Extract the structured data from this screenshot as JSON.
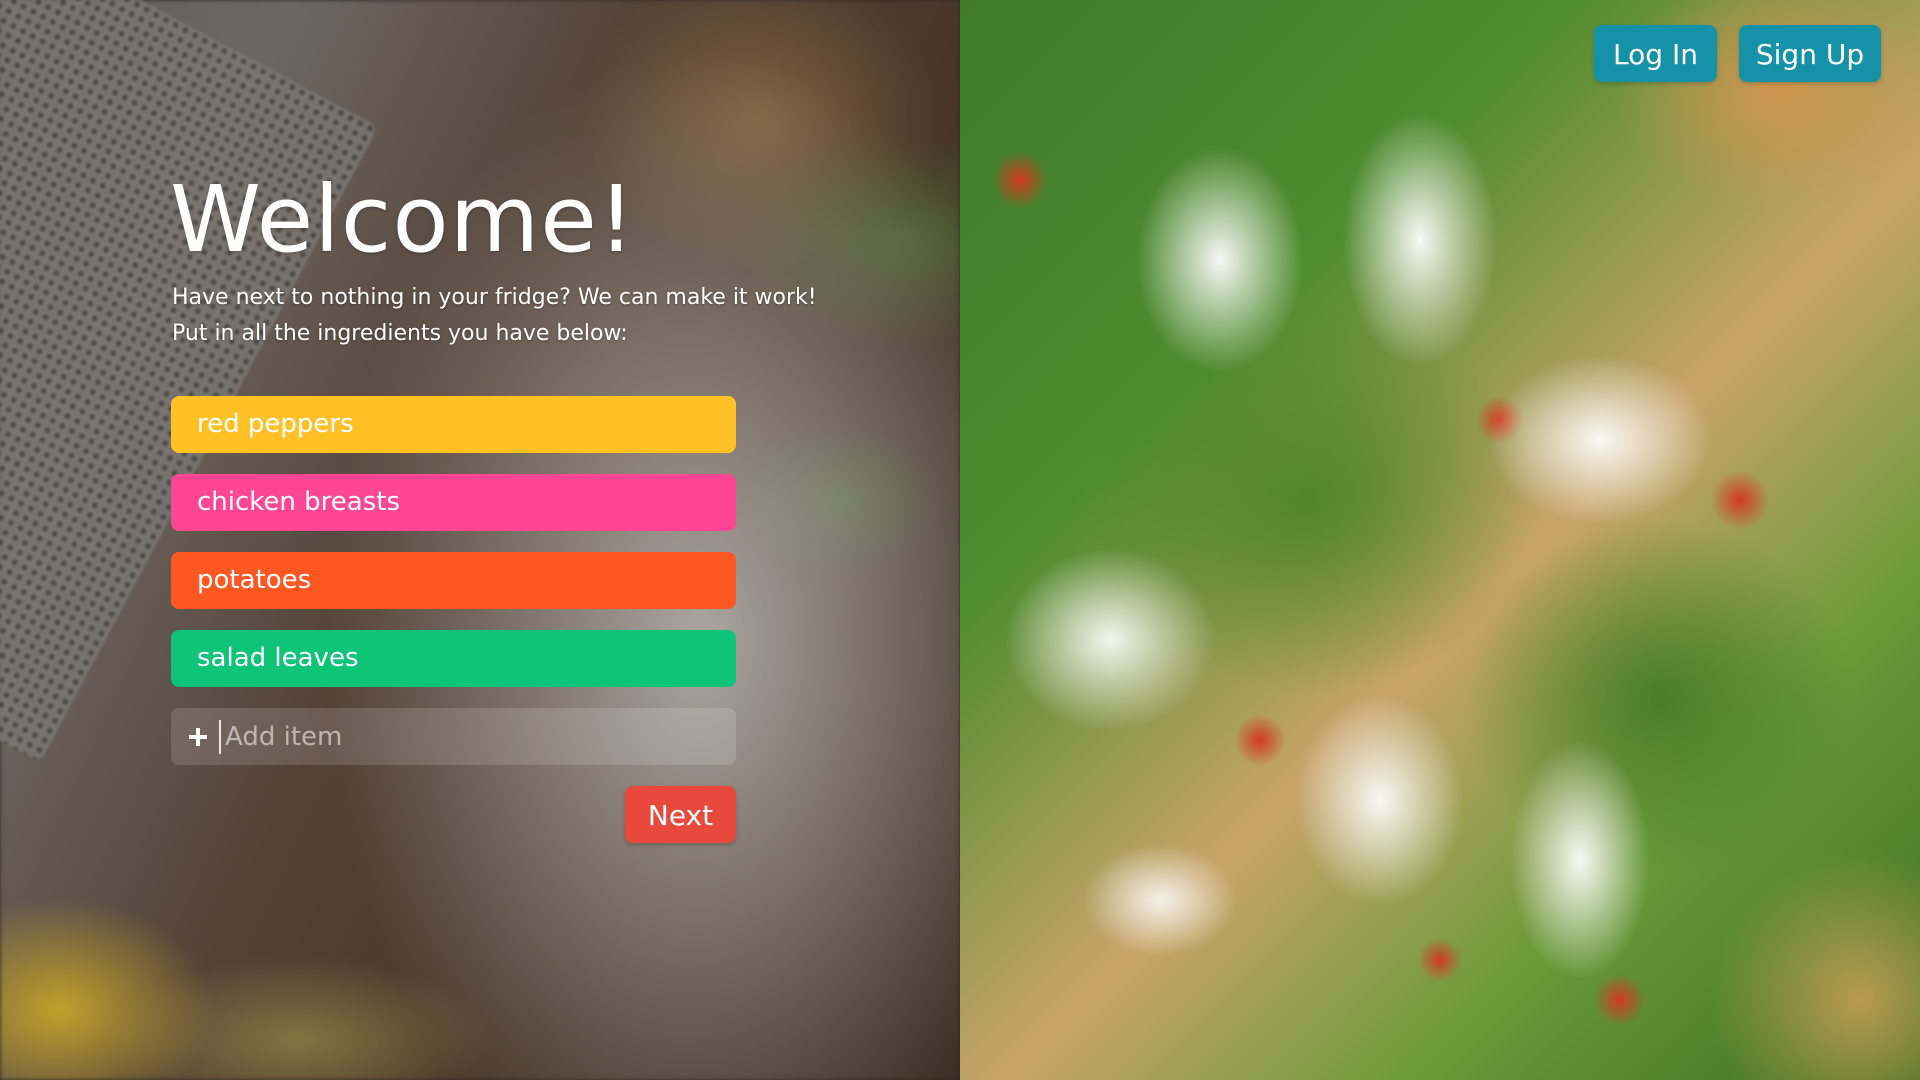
{
  "header": {
    "login_label": "Log In",
    "signup_label": "Sign Up"
  },
  "main": {
    "title": "Welcome!",
    "subtitle_line1": "Have next to nothing in your fridge? We can make it work!",
    "subtitle_line2": "Put in all the ingredients you have below:",
    "ingredients": [
      {
        "label": "red peppers",
        "color": "#ffc125"
      },
      {
        "label": "chicken breasts",
        "color": "#ff4694"
      },
      {
        "label": "potatoes",
        "color": "#ff5722"
      },
      {
        "label": "salad leaves",
        "color": "#0dc477"
      }
    ],
    "add_item": {
      "placeholder": "Add item",
      "value": ""
    },
    "next_label": "Next"
  },
  "colors": {
    "auth_button": "#1592a8",
    "next_button": "#e8493c"
  },
  "icons": {
    "add": "plus-icon"
  }
}
